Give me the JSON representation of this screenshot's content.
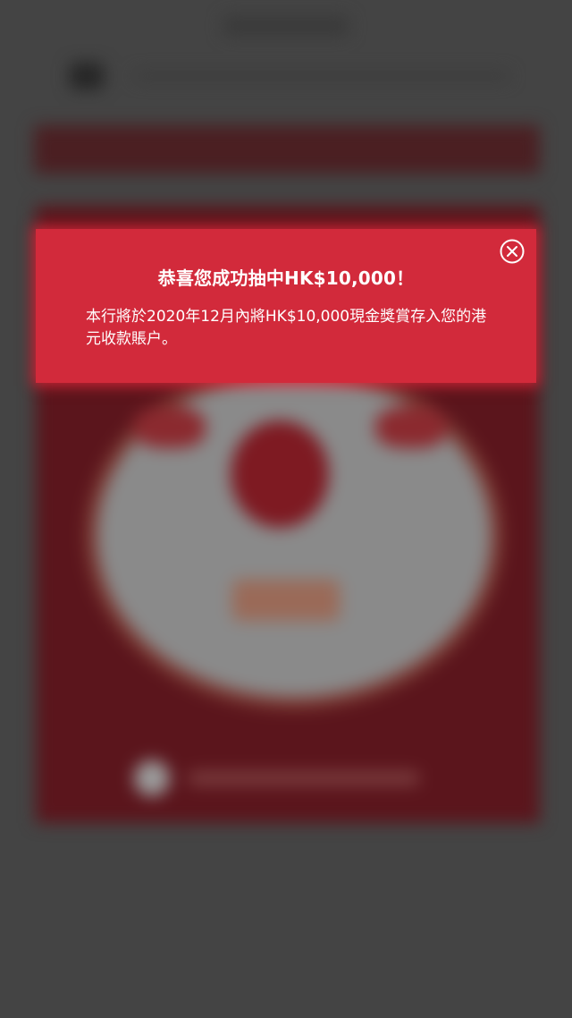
{
  "modal": {
    "title": "恭喜您成功抽中HK$10,000！",
    "message": "本行將於2020年12月內將HK$10,000現金獎賞存入您的港元收款賬户。",
    "close_icon": "close-circle-icon",
    "background_color": "#d22a3b"
  },
  "overlay": {
    "color": "#444444"
  }
}
